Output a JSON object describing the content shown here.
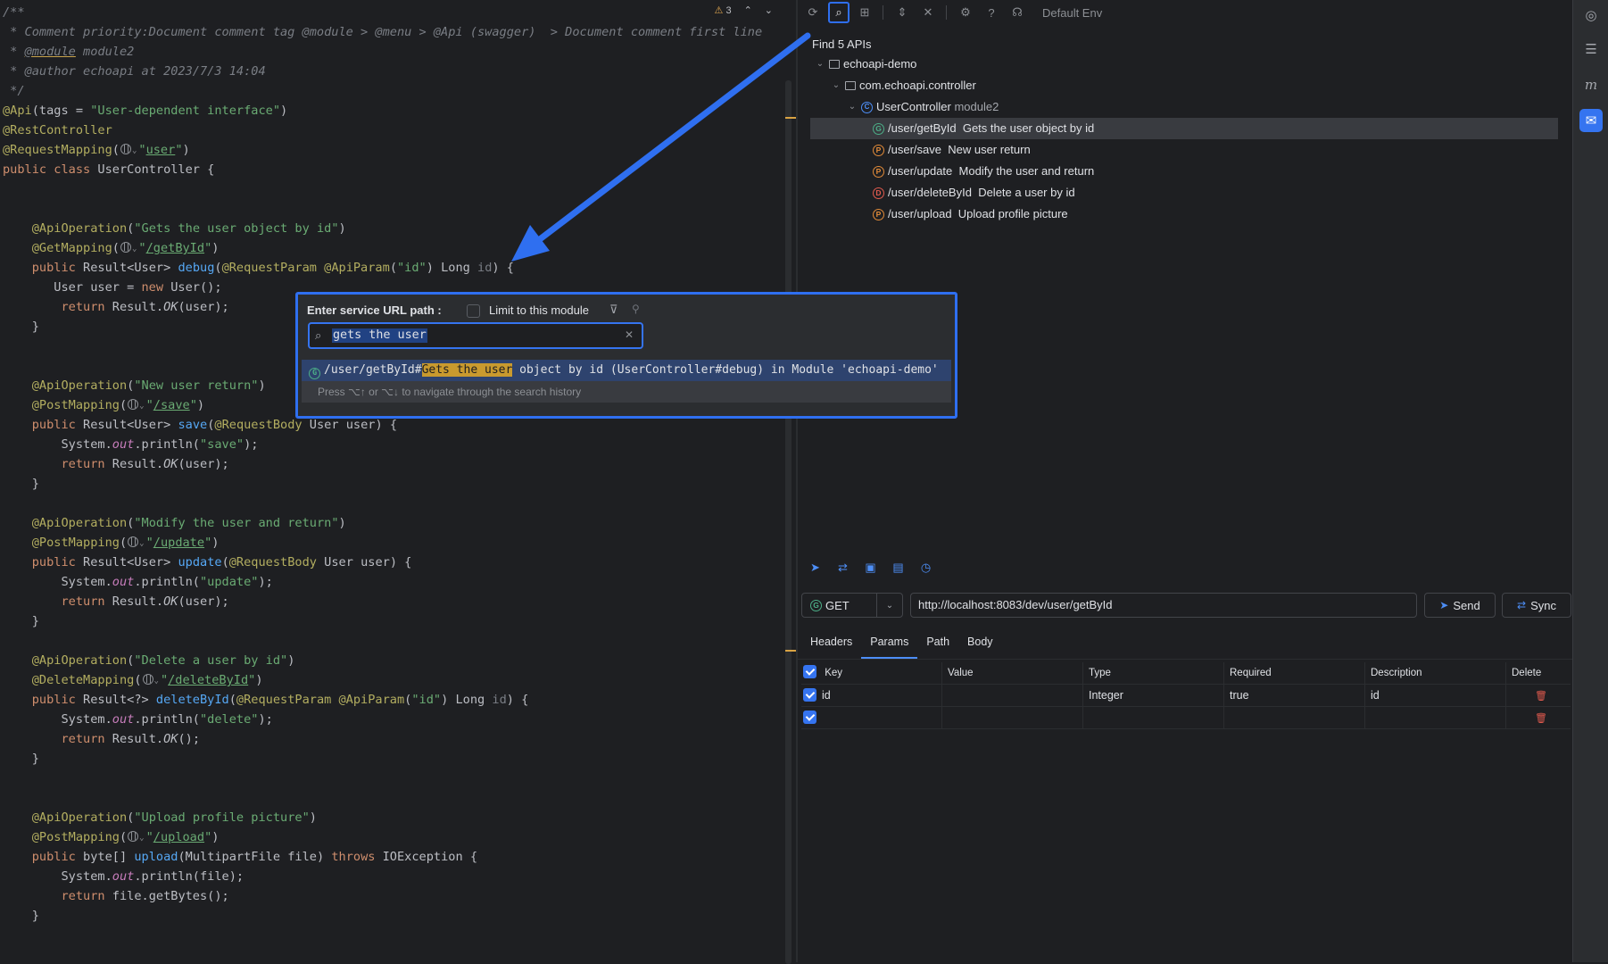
{
  "editor": {
    "header": {
      "warnings": "3"
    },
    "lines": [
      [
        {
          "c": "tok-comment",
          "t": "/**"
        }
      ],
      [
        {
          "c": "tok-comment",
          "t": " * Comment priority:Document comment tag @module > @menu > @Api (swagger)  > Document comment first line"
        }
      ],
      [
        {
          "c": "tok-comment",
          "t": " * "
        },
        {
          "c": "tok-doctag",
          "t": "@module"
        },
        {
          "c": "tok-comment",
          "t": " module2"
        }
      ],
      [
        {
          "c": "tok-comment",
          "t": " * "
        },
        {
          "c": "tok-comment",
          "t": "@author"
        },
        {
          "c": "tok-comment",
          "t": " echoapi at 2023/7/3 14:04"
        }
      ],
      [
        {
          "c": "tok-comment",
          "t": " */"
        }
      ],
      [
        {
          "c": "tok-ann",
          "t": "@Api"
        },
        {
          "c": "",
          "t": "(tags = "
        },
        {
          "c": "tok-str",
          "t": "\"User-dependent interface\""
        },
        {
          "c": "",
          "t": ")"
        }
      ],
      [
        {
          "c": "tok-ann",
          "t": "@RestController"
        }
      ],
      [
        {
          "c": "tok-ann",
          "t": "@RequestMapping"
        },
        {
          "c": "",
          "t": "("
        },
        {
          "c": "globe",
          "t": ""
        },
        {
          "c": "caret-s",
          "t": "⌄"
        },
        {
          "c": "tok-str",
          "t": "\""
        },
        {
          "c": "tok-strlink",
          "t": "user"
        },
        {
          "c": "tok-str",
          "t": "\""
        },
        {
          "c": "",
          "t": ")"
        }
      ],
      [
        {
          "c": "tok-kw",
          "t": "public class "
        },
        {
          "c": "",
          "t": "UserController {"
        }
      ],
      [],
      [],
      [
        {
          "c": "",
          "t": "    "
        },
        {
          "c": "tok-ann",
          "t": "@ApiOperation"
        },
        {
          "c": "",
          "t": "("
        },
        {
          "c": "tok-str",
          "t": "\"Gets the user object by id\""
        },
        {
          "c": "",
          "t": ")"
        }
      ],
      [
        {
          "c": "",
          "t": "    "
        },
        {
          "c": "tok-ann",
          "t": "@GetMapping"
        },
        {
          "c": "",
          "t": "("
        },
        {
          "c": "globe",
          "t": ""
        },
        {
          "c": "caret-s",
          "t": "⌄"
        },
        {
          "c": "tok-str",
          "t": "\""
        },
        {
          "c": "tok-strlink",
          "t": "/getById"
        },
        {
          "c": "tok-str",
          "t": "\""
        },
        {
          "c": "",
          "t": ")"
        }
      ],
      [
        {
          "c": "",
          "t": "    "
        },
        {
          "c": "tok-kw",
          "t": "public "
        },
        {
          "c": "",
          "t": "Result<User> "
        },
        {
          "c": "tok-fn",
          "t": "debug"
        },
        {
          "c": "",
          "t": "("
        },
        {
          "c": "tok-ann",
          "t": "@RequestParam @ApiParam"
        },
        {
          "c": "",
          "t": "("
        },
        {
          "c": "tok-str",
          "t": "\"id\""
        },
        {
          "c": "",
          "t": ") Long "
        },
        {
          "c": "tok-param",
          "t": "id"
        },
        {
          "c": "",
          "t": ") {"
        }
      ],
      [
        {
          "c": "",
          "t": "       User user = "
        },
        {
          "c": "tok-kw",
          "t": "new "
        },
        {
          "c": "",
          "t": "User();"
        }
      ],
      [
        {
          "c": "",
          "t": "        "
        },
        {
          "c": "tok-kw",
          "t": "return "
        },
        {
          "c": "",
          "t": "Result."
        },
        {
          "c": "tok-italic",
          "t": "OK"
        },
        {
          "c": "",
          "t": "(user);"
        }
      ],
      [
        {
          "c": "",
          "t": "    }"
        }
      ],
      [],
      [],
      [
        {
          "c": "",
          "t": "    "
        },
        {
          "c": "tok-ann",
          "t": "@ApiOperation"
        },
        {
          "c": "",
          "t": "("
        },
        {
          "c": "tok-str",
          "t": "\"New user return\""
        },
        {
          "c": "",
          "t": ")"
        }
      ],
      [
        {
          "c": "",
          "t": "    "
        },
        {
          "c": "tok-ann",
          "t": "@PostMapping"
        },
        {
          "c": "",
          "t": "("
        },
        {
          "c": "globe",
          "t": ""
        },
        {
          "c": "caret-s",
          "t": "⌄"
        },
        {
          "c": "tok-str",
          "t": "\""
        },
        {
          "c": "tok-strlink",
          "t": "/save"
        },
        {
          "c": "tok-str",
          "t": "\""
        },
        {
          "c": "",
          "t": ")"
        }
      ],
      [
        {
          "c": "",
          "t": "    "
        },
        {
          "c": "tok-kw",
          "t": "public "
        },
        {
          "c": "",
          "t": "Result<User> "
        },
        {
          "c": "tok-fn",
          "t": "save"
        },
        {
          "c": "",
          "t": "("
        },
        {
          "c": "tok-ann",
          "t": "@RequestBody "
        },
        {
          "c": "",
          "t": "User user) {"
        }
      ],
      [
        {
          "c": "",
          "t": "        System."
        },
        {
          "c": "tok-static",
          "t": "out"
        },
        {
          "c": "",
          "t": ".println("
        },
        {
          "c": "tok-str",
          "t": "\"save\""
        },
        {
          "c": "",
          "t": ");"
        }
      ],
      [
        {
          "c": "",
          "t": "        "
        },
        {
          "c": "tok-kw",
          "t": "return "
        },
        {
          "c": "",
          "t": "Result."
        },
        {
          "c": "tok-italic",
          "t": "OK"
        },
        {
          "c": "",
          "t": "(user);"
        }
      ],
      [
        {
          "c": "",
          "t": "    }"
        }
      ],
      [],
      [
        {
          "c": "",
          "t": "    "
        },
        {
          "c": "tok-ann",
          "t": "@ApiOperation"
        },
        {
          "c": "",
          "t": "("
        },
        {
          "c": "tok-str",
          "t": "\"Modify the user and return\""
        },
        {
          "c": "",
          "t": ")"
        }
      ],
      [
        {
          "c": "",
          "t": "    "
        },
        {
          "c": "tok-ann",
          "t": "@PostMapping"
        },
        {
          "c": "",
          "t": "("
        },
        {
          "c": "globe",
          "t": ""
        },
        {
          "c": "caret-s",
          "t": "⌄"
        },
        {
          "c": "tok-str",
          "t": "\""
        },
        {
          "c": "tok-strlink",
          "t": "/update"
        },
        {
          "c": "tok-str",
          "t": "\""
        },
        {
          "c": "",
          "t": ")"
        }
      ],
      [
        {
          "c": "",
          "t": "    "
        },
        {
          "c": "tok-kw",
          "t": "public "
        },
        {
          "c": "",
          "t": "Result<User> "
        },
        {
          "c": "tok-fn",
          "t": "update"
        },
        {
          "c": "",
          "t": "("
        },
        {
          "c": "tok-ann",
          "t": "@RequestBody "
        },
        {
          "c": "",
          "t": "User user) {"
        }
      ],
      [
        {
          "c": "",
          "t": "        System."
        },
        {
          "c": "tok-static",
          "t": "out"
        },
        {
          "c": "",
          "t": ".println("
        },
        {
          "c": "tok-str",
          "t": "\"update\""
        },
        {
          "c": "",
          "t": ");"
        }
      ],
      [
        {
          "c": "",
          "t": "        "
        },
        {
          "c": "tok-kw",
          "t": "return "
        },
        {
          "c": "",
          "t": "Result."
        },
        {
          "c": "tok-italic",
          "t": "OK"
        },
        {
          "c": "",
          "t": "(user);"
        }
      ],
      [
        {
          "c": "",
          "t": "    }"
        }
      ],
      [],
      [
        {
          "c": "",
          "t": "    "
        },
        {
          "c": "tok-ann",
          "t": "@ApiOperation"
        },
        {
          "c": "",
          "t": "("
        },
        {
          "c": "tok-str",
          "t": "\"Delete a user by id\""
        },
        {
          "c": "",
          "t": ")"
        }
      ],
      [
        {
          "c": "",
          "t": "    "
        },
        {
          "c": "tok-ann",
          "t": "@DeleteMapping"
        },
        {
          "c": "",
          "t": "("
        },
        {
          "c": "globe",
          "t": ""
        },
        {
          "c": "caret-s",
          "t": "⌄"
        },
        {
          "c": "tok-str",
          "t": "\""
        },
        {
          "c": "tok-strlink",
          "t": "/deleteById"
        },
        {
          "c": "tok-str",
          "t": "\""
        },
        {
          "c": "",
          "t": ")"
        }
      ],
      [
        {
          "c": "",
          "t": "    "
        },
        {
          "c": "tok-kw",
          "t": "public "
        },
        {
          "c": "",
          "t": "Result<?> "
        },
        {
          "c": "tok-fn",
          "t": "deleteById"
        },
        {
          "c": "",
          "t": "("
        },
        {
          "c": "tok-ann",
          "t": "@RequestParam @ApiParam"
        },
        {
          "c": "",
          "t": "("
        },
        {
          "c": "tok-str",
          "t": "\"id\""
        },
        {
          "c": "",
          "t": ") Long "
        },
        {
          "c": "tok-param",
          "t": "id"
        },
        {
          "c": "",
          "t": ") {"
        }
      ],
      [
        {
          "c": "",
          "t": "        System."
        },
        {
          "c": "tok-static",
          "t": "out"
        },
        {
          "c": "",
          "t": ".println("
        },
        {
          "c": "tok-str",
          "t": "\"delete\""
        },
        {
          "c": "",
          "t": ");"
        }
      ],
      [
        {
          "c": "",
          "t": "        "
        },
        {
          "c": "tok-kw",
          "t": "return "
        },
        {
          "c": "",
          "t": "Result."
        },
        {
          "c": "tok-italic",
          "t": "OK"
        },
        {
          "c": "",
          "t": "();"
        }
      ],
      [
        {
          "c": "",
          "t": "    }"
        }
      ],
      [],
      [],
      [
        {
          "c": "",
          "t": "    "
        },
        {
          "c": "tok-ann",
          "t": "@ApiOperation"
        },
        {
          "c": "",
          "t": "("
        },
        {
          "c": "tok-str",
          "t": "\"Upload profile picture\""
        },
        {
          "c": "",
          "t": ")"
        }
      ],
      [
        {
          "c": "",
          "t": "    "
        },
        {
          "c": "tok-ann",
          "t": "@PostMapping"
        },
        {
          "c": "",
          "t": "("
        },
        {
          "c": "globe",
          "t": ""
        },
        {
          "c": "caret-s",
          "t": "⌄"
        },
        {
          "c": "tok-str",
          "t": "\""
        },
        {
          "c": "tok-strlink",
          "t": "/upload"
        },
        {
          "c": "tok-str",
          "t": "\""
        },
        {
          "c": "",
          "t": ")"
        }
      ],
      [
        {
          "c": "",
          "t": "    "
        },
        {
          "c": "tok-kw",
          "t": "public "
        },
        {
          "c": "",
          "t": "byte[] "
        },
        {
          "c": "tok-fn",
          "t": "upload"
        },
        {
          "c": "",
          "t": "(MultipartFile file) "
        },
        {
          "c": "tok-kw",
          "t": "throws "
        },
        {
          "c": "",
          "t": "IOException {"
        }
      ],
      [
        {
          "c": "",
          "t": "        System."
        },
        {
          "c": "tok-static",
          "t": "out"
        },
        {
          "c": "",
          "t": ".println(file);"
        }
      ],
      [
        {
          "c": "",
          "t": "        "
        },
        {
          "c": "tok-kw",
          "t": "return "
        },
        {
          "c": "",
          "t": "file.getBytes();"
        }
      ],
      [
        {
          "c": "",
          "t": "    }"
        }
      ]
    ]
  },
  "toolbar": {
    "icons": [
      "refresh-icon",
      "search-icon",
      "tree-icon",
      "expand-icon",
      "collapse-icon",
      "settings-icon",
      "help-icon",
      "headset-icon"
    ],
    "env_label": "Default Env"
  },
  "api_tree": {
    "found_label": "Find 5 APIs",
    "project": "echoapi-demo",
    "package": "com.echoapi.controller",
    "controller": "UserController",
    "module": "module2",
    "endpoints": [
      {
        "method": "G",
        "path": "/user/getById",
        "desc": "Gets the user object by id",
        "selected": true
      },
      {
        "method": "P",
        "path": "/user/save",
        "desc": "New user return",
        "selected": false
      },
      {
        "method": "P",
        "path": "/user/update",
        "desc": "Modify the user and return",
        "selected": false
      },
      {
        "method": "D",
        "path": "/user/deleteById",
        "desc": "Delete a user by id",
        "selected": false
      },
      {
        "method": "P",
        "path": "/user/upload",
        "desc": "Upload profile picture",
        "selected": false
      }
    ]
  },
  "request": {
    "method_badge": "G",
    "method": "GET",
    "url": "http://localhost:8083/dev/user/getById",
    "send_label": "Send",
    "sync_label": "Sync",
    "tabs": [
      "Headers",
      "Params",
      "Path",
      "Body"
    ],
    "active_tab": "Params",
    "params_headers": [
      "Key",
      "Value",
      "Type",
      "Required",
      "Description",
      "Delete"
    ],
    "params_rows": [
      {
        "checked": true,
        "key": "id",
        "value": "",
        "type": "Integer",
        "required": "true",
        "description": "id"
      },
      {
        "checked": true,
        "key": "",
        "value": "",
        "type": "",
        "required": "",
        "description": ""
      }
    ]
  },
  "search_popup": {
    "title": "Enter service URL path :",
    "limit_label": "Limit to this module",
    "query": "gets the user",
    "result": {
      "method_badge": "G",
      "before": "/user/getById#",
      "highlight": "Gets the user",
      "after": " object by id (UserController#debug) in Module 'echoapi-demo'"
    },
    "hint": "Press ⌥↑ or ⌥↓ to navigate through the search history"
  },
  "colors": {
    "accent": "#2f6ff0",
    "get": "#4cae87",
    "post": "#e08a39",
    "delete": "#e05a4e",
    "highlight": "#c99a2e"
  }
}
